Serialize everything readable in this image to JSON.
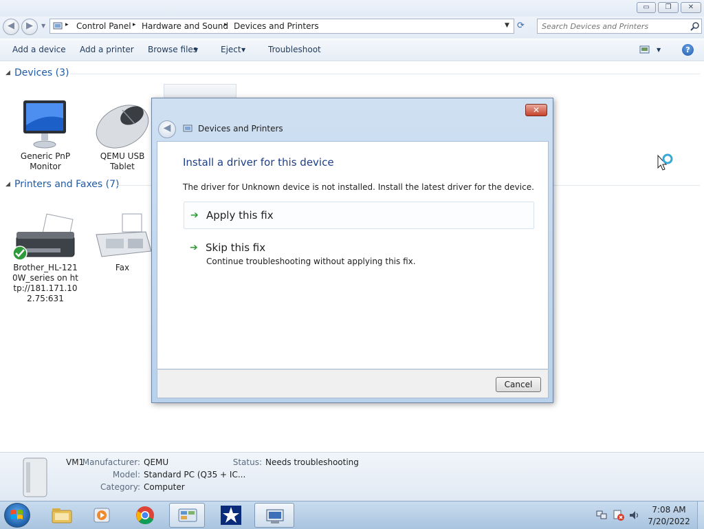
{
  "window": {
    "minimize_glyph": "▭",
    "restore_glyph": "❐",
    "close_glyph": "✕"
  },
  "nav": {
    "back_glyph": "◀",
    "forward_glyph": "▶",
    "breadcrumb": [
      "Control Panel",
      "Hardware and Sound",
      "Devices and Printers"
    ],
    "breadcrumb_separator": "▸",
    "search_placeholder": "Search Devices and Printers"
  },
  "toolbar": {
    "add_device": "Add a device",
    "add_printer": "Add a printer",
    "browse_files": "Browse files",
    "eject": "Eject",
    "troubleshoot": "Troubleshoot",
    "dropdown_glyph": "▼",
    "help_glyph": "?"
  },
  "groups": {
    "devices": {
      "label": "Devices (3)"
    },
    "printers": {
      "label": "Printers and Faxes (7)"
    }
  },
  "devices": [
    {
      "label": "Generic PnP Monitor",
      "icon": "monitor-icon"
    },
    {
      "label": "QEMU USB Tablet",
      "icon": "mouse-icon"
    }
  ],
  "printers": [
    {
      "label": "Brother_HL-1210W_series on http://181.171.102.75:631",
      "icon": "printer-icon",
      "default": true
    },
    {
      "label": "Fax",
      "icon": "fax-icon"
    }
  ],
  "details": {
    "name": "VM1",
    "manufacturer_label": "Manufacturer:",
    "manufacturer": "QEMU",
    "model_label": "Model:",
    "model": "Standard PC (Q35 + IC...",
    "category_label": "Category:",
    "category": "Computer",
    "status_label": "Status:",
    "status": "Needs troubleshooting"
  },
  "dialog": {
    "title": "Devices and Printers",
    "heading": "Install a driver for this device",
    "description": "The driver for Unknown device is not installed. Install the latest driver for the device.",
    "apply_fix": "Apply this fix",
    "skip_fix": "Skip this fix",
    "skip_fix_sub": "Continue troubleshooting without applying this fix.",
    "cancel": "Cancel",
    "close_glyph": "✕",
    "back_glyph": "◀",
    "arrow_glyph": "➔"
  },
  "taskbar": {
    "time": "7:08 AM",
    "date": "7/20/2022"
  },
  "colors": {
    "accent": "#1e5aa8",
    "link": "#1c3d8c",
    "fix_arrow": "#2e9b35"
  }
}
